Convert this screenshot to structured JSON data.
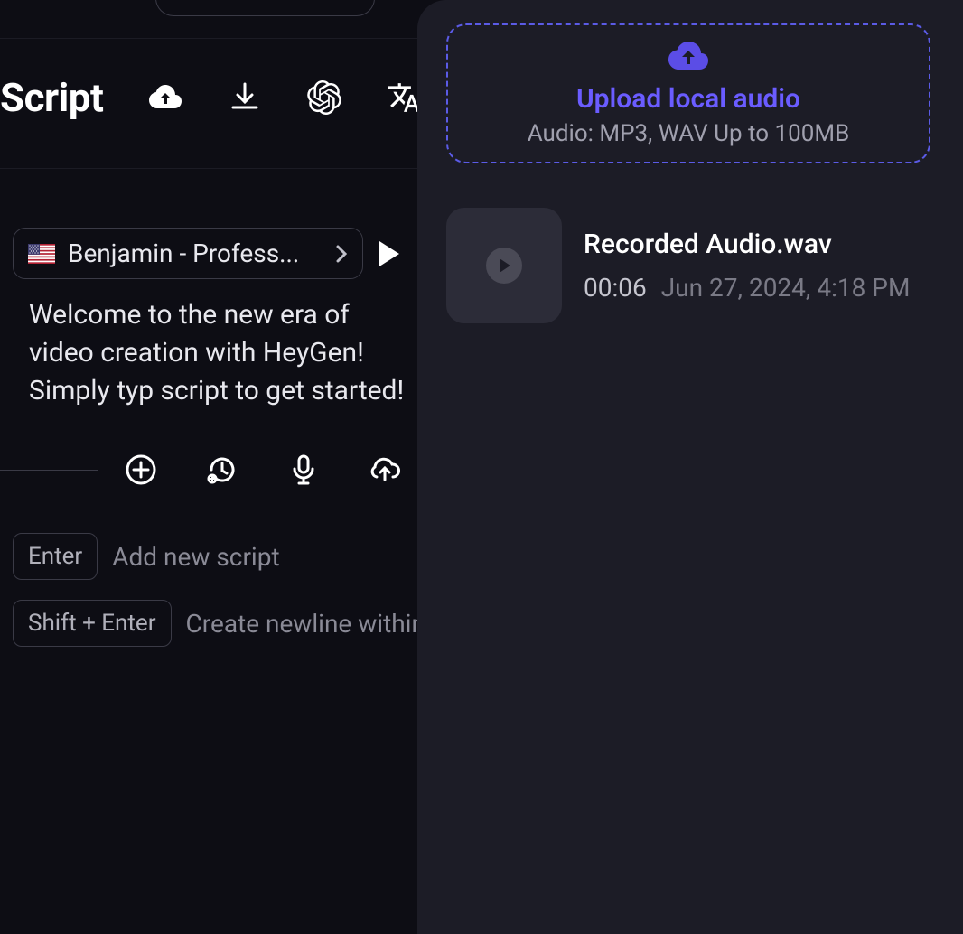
{
  "header": {
    "title": "Script"
  },
  "voice": {
    "name": "Benjamin - Profess..."
  },
  "script": {
    "text": "Welcome to the new era of video creation with HeyGen! Simply typ script to get started!"
  },
  "hints": {
    "enter_key": "Enter",
    "enter_label": "Add new script",
    "shift_enter_key": "Shift + Enter",
    "shift_enter_label": "Create newline within pa"
  },
  "upload": {
    "title": "Upload local audio",
    "subtitle": "Audio: MP3, WAV Up to 100MB"
  },
  "audio": {
    "filename": "Recorded Audio.wav",
    "duration": "00:06",
    "date": "Jun 27, 2024, 4:18 PM"
  }
}
